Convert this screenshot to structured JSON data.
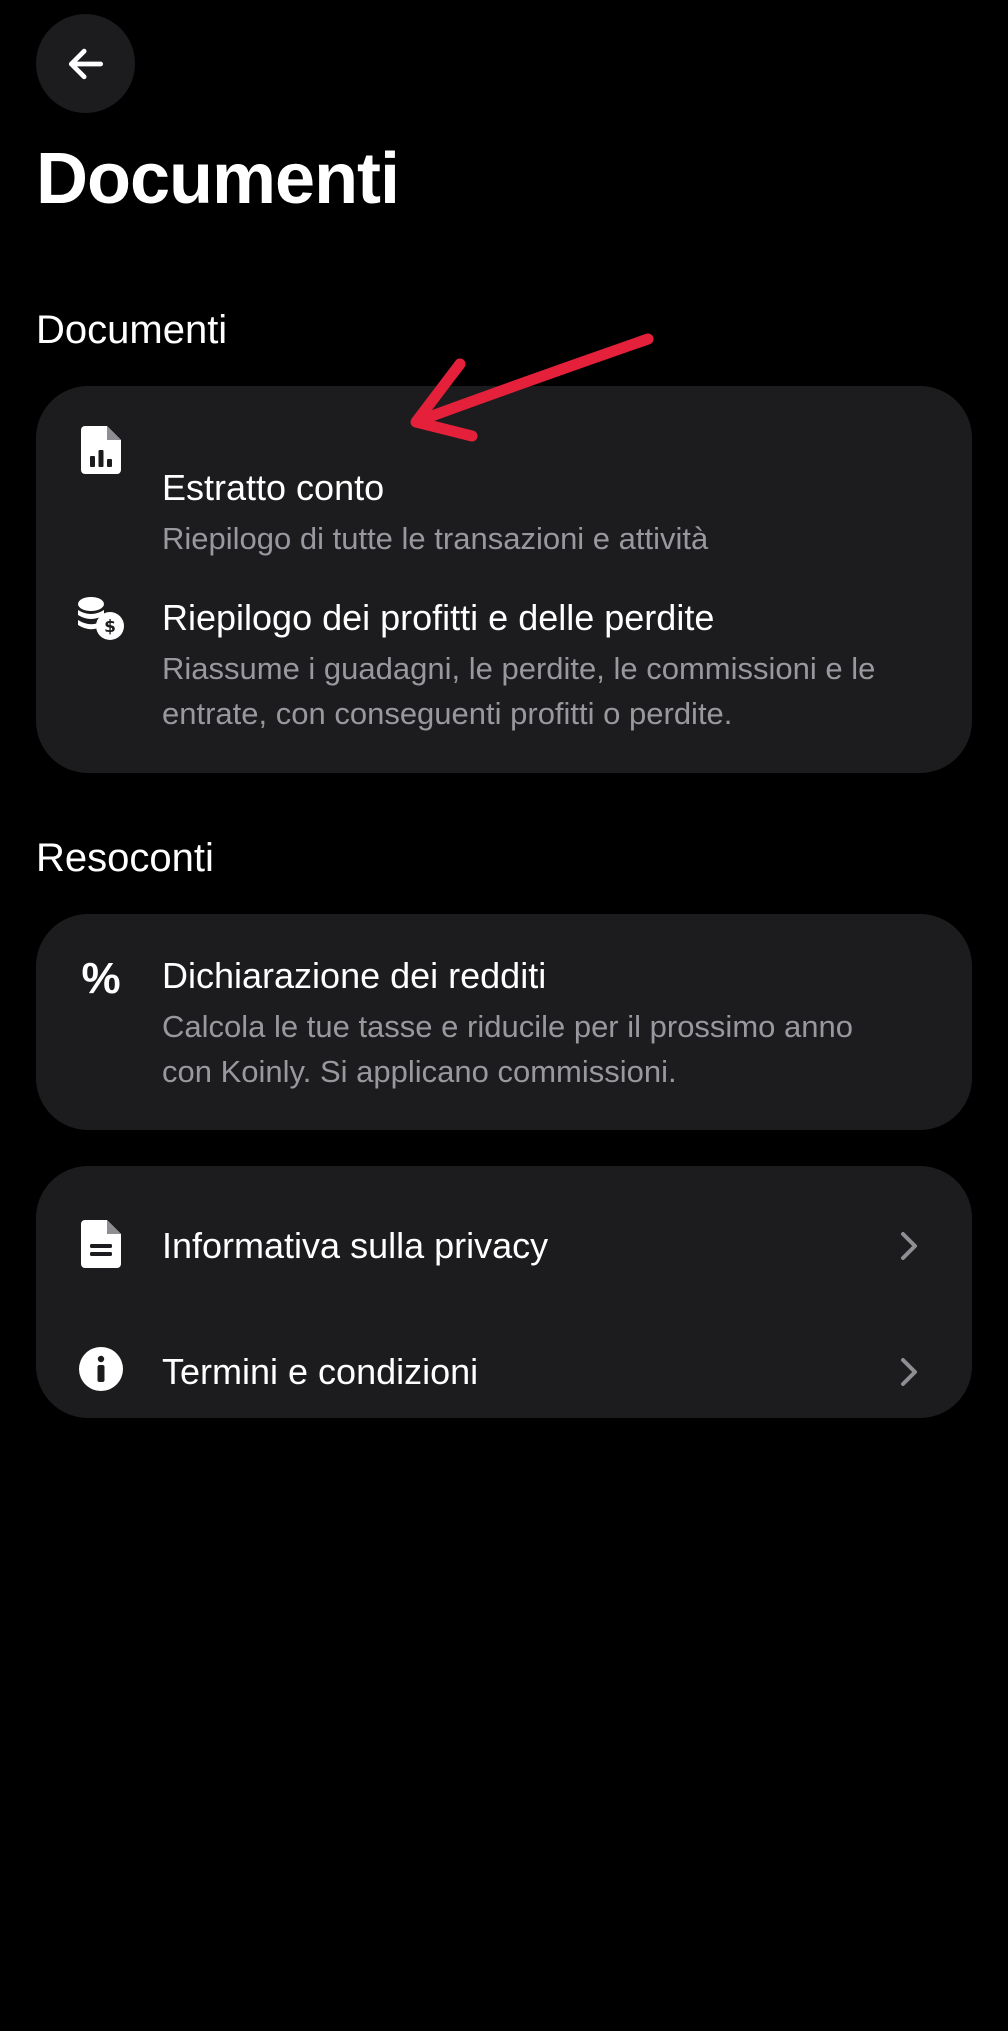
{
  "header": {
    "back_icon": "arrow-left-icon",
    "title": "Documenti"
  },
  "sections": {
    "documents": {
      "header": "Documenti",
      "items": [
        {
          "icon": "file-chart-icon",
          "title": "Estratto conto",
          "subtitle": "Riepilogo di tutte le transazioni e attività"
        },
        {
          "icon": "coins-dollar-icon",
          "title": "Riepilogo dei profitti e delle perdite",
          "subtitle": "Riassume i guadagni, le perdite, le commissioni e le entrate, con conseguenti profitti o perdite."
        }
      ]
    },
    "reports": {
      "header": "Resoconti",
      "items": [
        {
          "icon": "percent-icon",
          "icon_glyph": "%",
          "title": "Dichiarazione dei redditi",
          "subtitle": "Calcola le tue tasse e riducile per il prossimo anno con Koinly. Si applicano commissioni."
        }
      ]
    },
    "legal": {
      "items": [
        {
          "icon": "file-text-icon",
          "title": "Informativa sulla privacy",
          "chevron": "chevron-right-icon"
        },
        {
          "icon": "info-circle-icon",
          "title": "Termini e condizioni",
          "chevron": "chevron-right-icon"
        }
      ]
    }
  },
  "colors": {
    "background": "#000000",
    "card": "#1c1c1e",
    "text_primary": "#ffffff",
    "text_secondary": "#98989e",
    "annotation_arrow": "#e5203a"
  }
}
